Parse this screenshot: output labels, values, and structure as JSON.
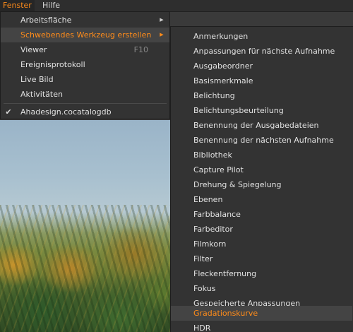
{
  "menubar": {
    "items": [
      {
        "label": "Fenster",
        "active": true
      },
      {
        "label": "Hilfe",
        "active": false
      }
    ]
  },
  "primary_menu": {
    "items": [
      {
        "label": "Arbeitsfläche",
        "has_submenu": true,
        "shortcut": ""
      },
      {
        "label": "Schwebendes Werkzeug erstellen",
        "has_submenu": true,
        "shortcut": "",
        "highlighted": true
      },
      {
        "label": "Viewer",
        "has_submenu": false,
        "shortcut": "F10"
      },
      {
        "label": "Ereignisprotokoll",
        "has_submenu": false,
        "shortcut": ""
      },
      {
        "label": "Live Bild",
        "has_submenu": false,
        "shortcut": ""
      },
      {
        "label": "Aktivitäten",
        "has_submenu": false,
        "shortcut": ""
      },
      {
        "label": "Ahadesign.cocatalogdb",
        "has_submenu": false,
        "shortcut": "",
        "checked": true
      }
    ]
  },
  "submenu": {
    "items": [
      "Anmerkungen",
      "Anpassungen für nächste Aufnahme",
      "Ausgabeordner",
      "Basismerkmale",
      "Belichtung",
      "Belichtungsbeurteilung",
      "Benennung der Ausgabedateien",
      "Benennung der nächsten Aufnahme",
      "Bibliothek",
      "Capture Pilot",
      "Drehung & Spiegelung",
      "Ebenen",
      "Farbbalance",
      "Farbeditor",
      "Filmkorn",
      "Filter",
      "Fleckentfernung",
      "Fokus",
      "Gespeicherte Anpassungen",
      "Gradationskurve",
      "HDR"
    ],
    "highlighted_index": 19
  },
  "colors": {
    "accent": "#ff8c1a",
    "menu_bg": "#333333",
    "highlight_bg": "#444444",
    "text": "#e2e2e2"
  },
  "icons": {
    "submenu_arrow": "chevron-right-icon",
    "checkmark": "checkmark-icon"
  }
}
